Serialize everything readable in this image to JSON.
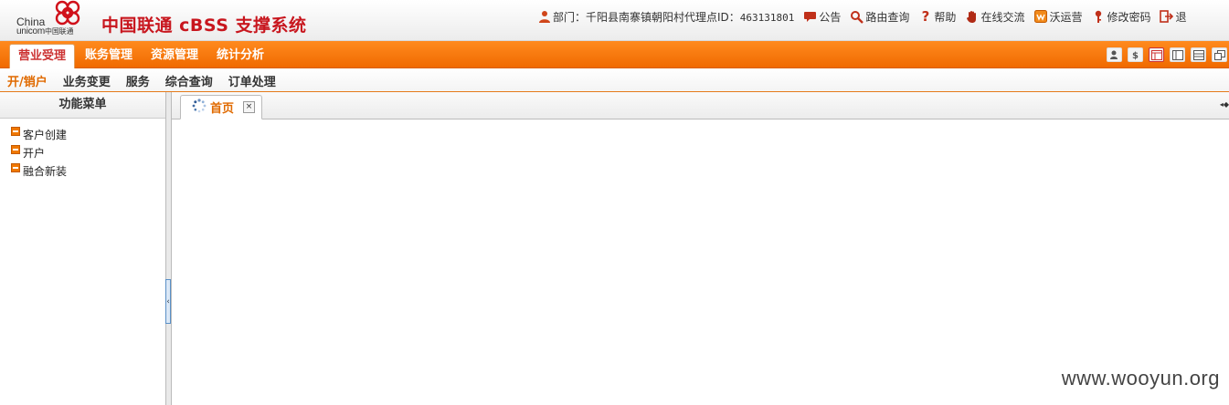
{
  "header": {
    "logo_china": "China",
    "logo_unicom": "unicom",
    "logo_unicom_cn": "中国联通",
    "app_title": "中国联通 cBSS 支撑系统",
    "dept_label": "部门：千阳县南寨镇朝阳村代理点ID：",
    "dept_id": "463131801",
    "links": [
      {
        "label": "公告",
        "icon": "announcement-icon"
      },
      {
        "label": "路由查询",
        "icon": "search-icon"
      },
      {
        "label": "帮助",
        "icon": "help-icon"
      },
      {
        "label": "在线交流",
        "icon": "hand-icon"
      },
      {
        "label": "沃运营",
        "icon": "wo-operations-icon"
      },
      {
        "label": "修改密码",
        "icon": "key-icon"
      },
      {
        "label": "退",
        "icon": "exit-icon"
      }
    ]
  },
  "main_nav": {
    "tabs": [
      "营业受理",
      "账务管理",
      "资源管理",
      "统计分析"
    ],
    "active_index": 0
  },
  "sub_nav": {
    "items": [
      "开/销户",
      "业务变更",
      "服务",
      "综合查询",
      "订单处理"
    ],
    "active_index": 0
  },
  "sidebar": {
    "title": "功能菜单",
    "items": [
      "客户创建",
      "开户",
      "融合新装"
    ]
  },
  "content": {
    "tab_label": "首页",
    "close_glyph": "×",
    "arrows": "◂◆"
  },
  "watermark": "www.wooyun.org",
  "colors": {
    "brand_red": "#c8161e",
    "nav_orange": "#f47a10",
    "accent_orange": "#e06a00"
  }
}
